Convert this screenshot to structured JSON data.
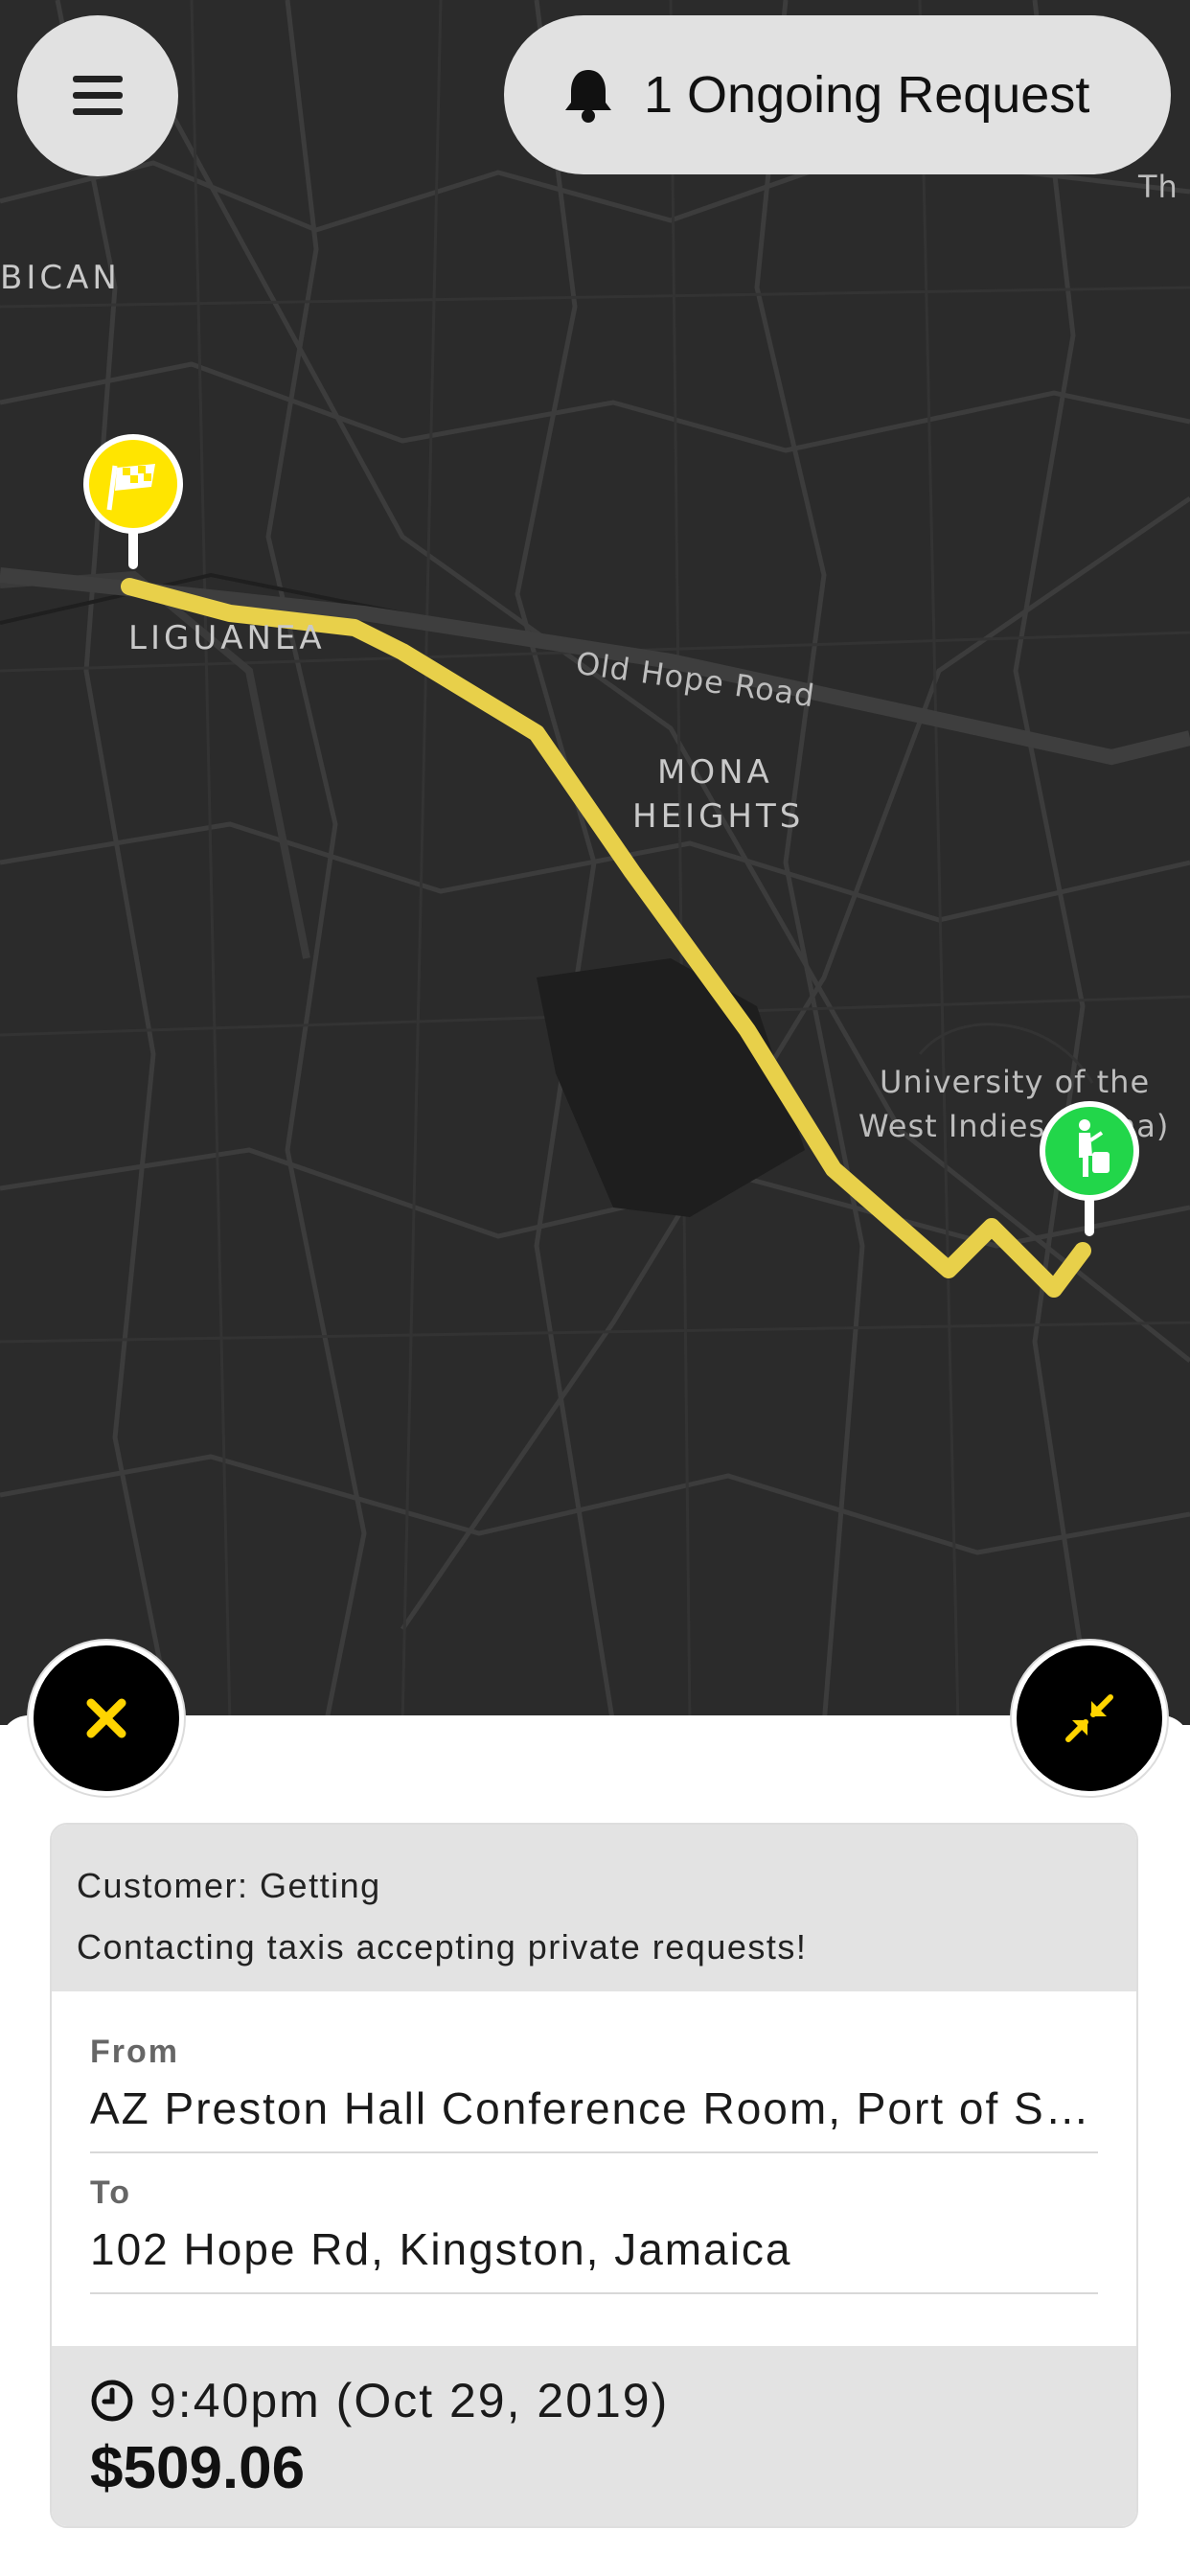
{
  "header": {
    "menu_icon": "hamburger-menu-icon",
    "notification_icon": "bell-icon",
    "ongoing_request_label": "1 Ongoing Request"
  },
  "map": {
    "labels": {
      "bican": "BICAN",
      "liguanea": "LIGUANEA",
      "old_hope_road": "Old Hope Road",
      "mona": "MONA",
      "heights": "HEIGHTS",
      "uwi_line1": "University of the",
      "uwi_line2": "West Indies (Mona)",
      "th": "Th"
    },
    "route_color": "#e8d04a",
    "destination_pin_color": "#ffe500",
    "pickup_pin_color": "#22d64a",
    "destination_icon": "checkered-flag-icon",
    "pickup_icon": "person-with-luggage-icon"
  },
  "actions": {
    "cancel_icon": "close-icon",
    "collapse_icon": "collapse-arrows-icon",
    "accent_color": "#ffd400"
  },
  "request": {
    "status_line1": "Customer: Getting",
    "status_line2": "Contacting taxis accepting private requests!",
    "from_label": "From",
    "from_value": "AZ Preston Hall Conference Room, Port of Spain",
    "to_label": "To",
    "to_value": "102 Hope Rd, Kingston, Jamaica",
    "time": "9:40pm (Oct 29, 2019)",
    "time_icon": "clock-icon",
    "price": "$509.06"
  }
}
